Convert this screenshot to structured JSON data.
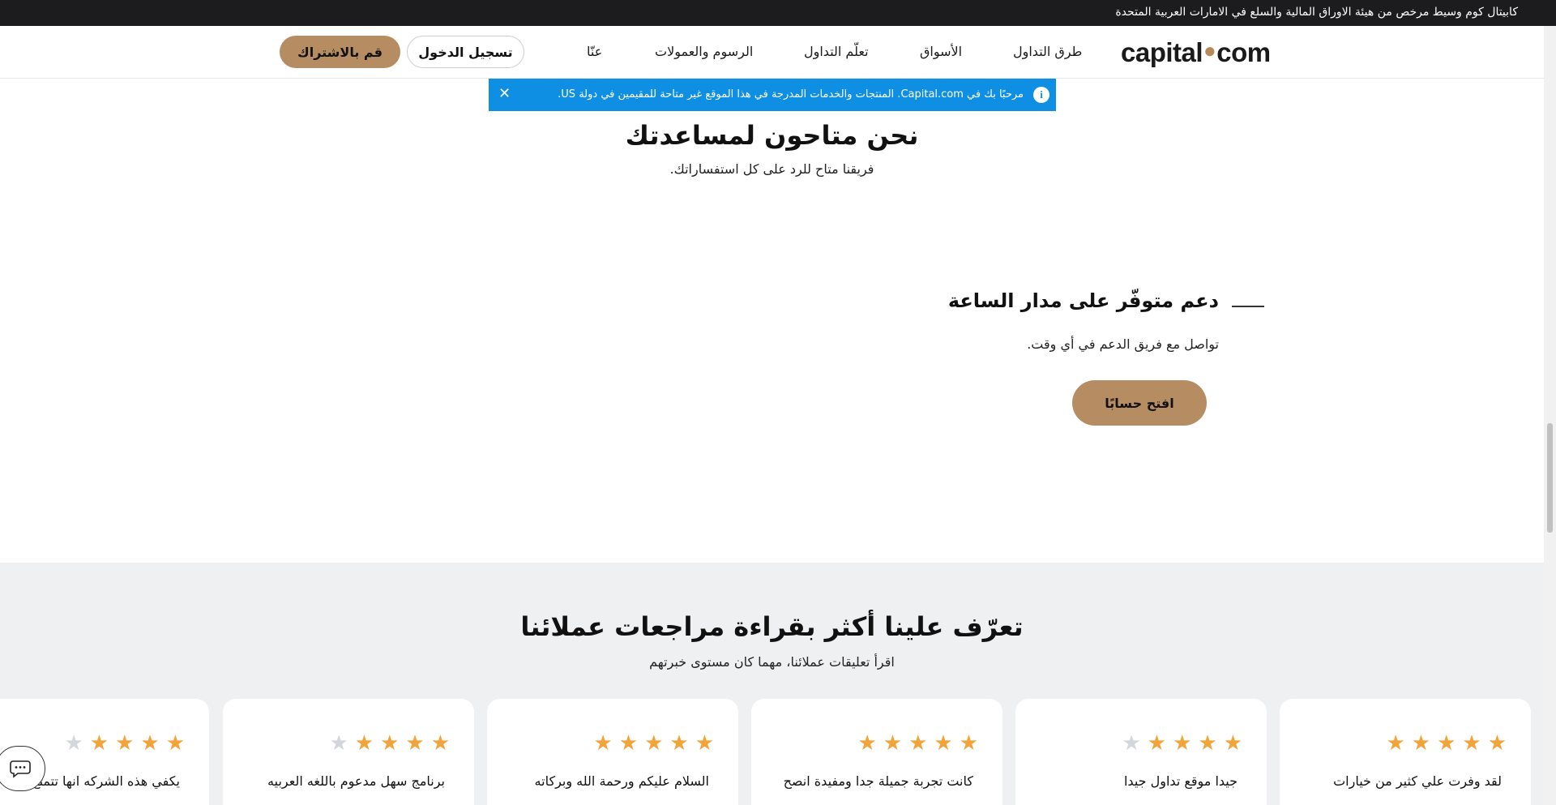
{
  "topbar": {
    "message": "كابيتال كوم وسيط مرخص من هيئة الاوراق المالية والسلع في الامارات العربية المتحدة"
  },
  "header": {
    "logo": {
      "part1": "capital",
      "part2": "com"
    },
    "nav": [
      {
        "label": "طرق التداول"
      },
      {
        "label": "الأسواق"
      },
      {
        "label": "تعلّم التداول"
      },
      {
        "label": "الرسوم والعمولات"
      },
      {
        "label": "عنّا"
      }
    ],
    "login_label": "تسجيل الدخول",
    "signup_label": "قم بالاشتراك"
  },
  "notice": {
    "text": "مرحبًا بك في Capital.com. المنتجات والخدمات المدرجة في هذا الموقع غير متاحة للمقيمين في دولة US.",
    "close_symbol": "✕",
    "info_symbol": "i"
  },
  "hero": {
    "title": "نحن متاحون لمساعدتك",
    "subtitle": "فريقنا متاح للرد على كل استفساراتك."
  },
  "support": {
    "title": "دعم متوفّر على مدار الساعة",
    "subtitle": "تواصل مع فريق الدعم في أي وقت.",
    "button": "افتح حسابًا"
  },
  "reviews": {
    "title": "تعرّف علينا أكثر بقراءة مراجعات عملائنا",
    "subtitle": "اقرأ تعليقات عملائنا، مهما كان مستوى خبرتهم",
    "star_symbol": "★",
    "cards": [
      {
        "rating": 5,
        "text": "لقد وفرت علي كثير من خيارات"
      },
      {
        "rating": 4,
        "text": "جيدا موقع تداول جيدا"
      },
      {
        "rating": 5,
        "text": "كانت تجربة جميلة جدا ومفيدة انصح"
      },
      {
        "rating": 5,
        "text": "السلام عليكم ورحمة الله وبركاته"
      },
      {
        "rating": 4,
        "text": "برنامج سهل مدعوم باللغه العربيه"
      },
      {
        "rating": 4,
        "text": "يكفي هذه الشركه انها تتمتع"
      }
    ]
  },
  "colors": {
    "accent": "#b68c62",
    "notice": "#0f8fe3",
    "star": "#f2a43a",
    "topbar": "#1c1c1e"
  }
}
